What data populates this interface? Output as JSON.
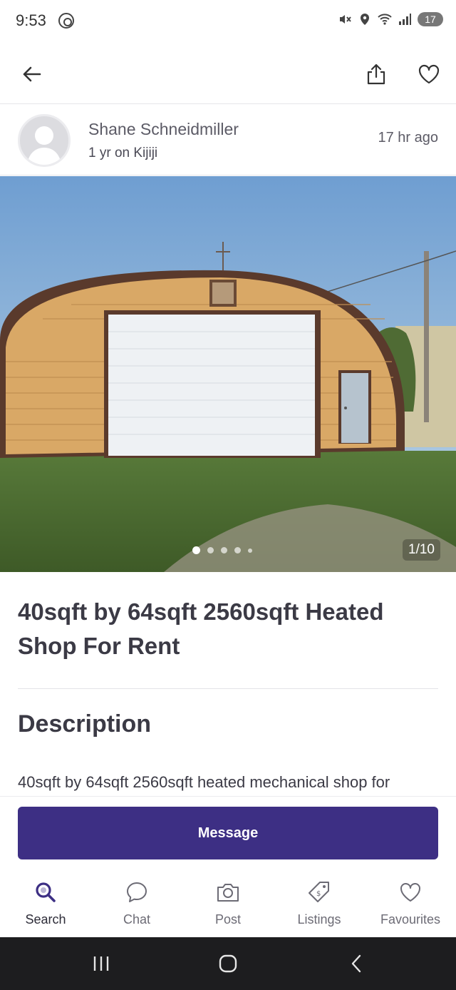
{
  "status_bar": {
    "time": "9:53",
    "battery": "17",
    "icons": [
      "at-icon",
      "mute-icon",
      "location-icon",
      "wifi-icon",
      "signal-icon",
      "battery-icon"
    ]
  },
  "top_nav": {
    "icons": [
      "back-arrow-icon",
      "share-icon",
      "heart-icon"
    ]
  },
  "seller": {
    "name": "Shane Schneidmiller",
    "tenure": "1 yr on Kijiji",
    "posted": "17 hr  ago"
  },
  "gallery": {
    "counter": "1/10",
    "total_images": 10,
    "current_image": 1
  },
  "listing": {
    "title": "40sqft by 64sqft 2560sqft Heated Shop For Rent",
    "description_heading": "Description",
    "description_text": "40sqft by 64sqft 2560sqft heated mechanical shop for"
  },
  "action": {
    "message_label": "Message"
  },
  "tabs": [
    {
      "label": "Search",
      "icon": "search-icon"
    },
    {
      "label": "Chat",
      "icon": "chat-icon"
    },
    {
      "label": "Post",
      "icon": "camera-icon"
    },
    {
      "label": "Listings",
      "icon": "tag-icon"
    },
    {
      "label": "Favourites",
      "icon": "heart-icon"
    }
  ],
  "colors": {
    "accent": "#3d2f84",
    "text": "#3b3a45"
  }
}
